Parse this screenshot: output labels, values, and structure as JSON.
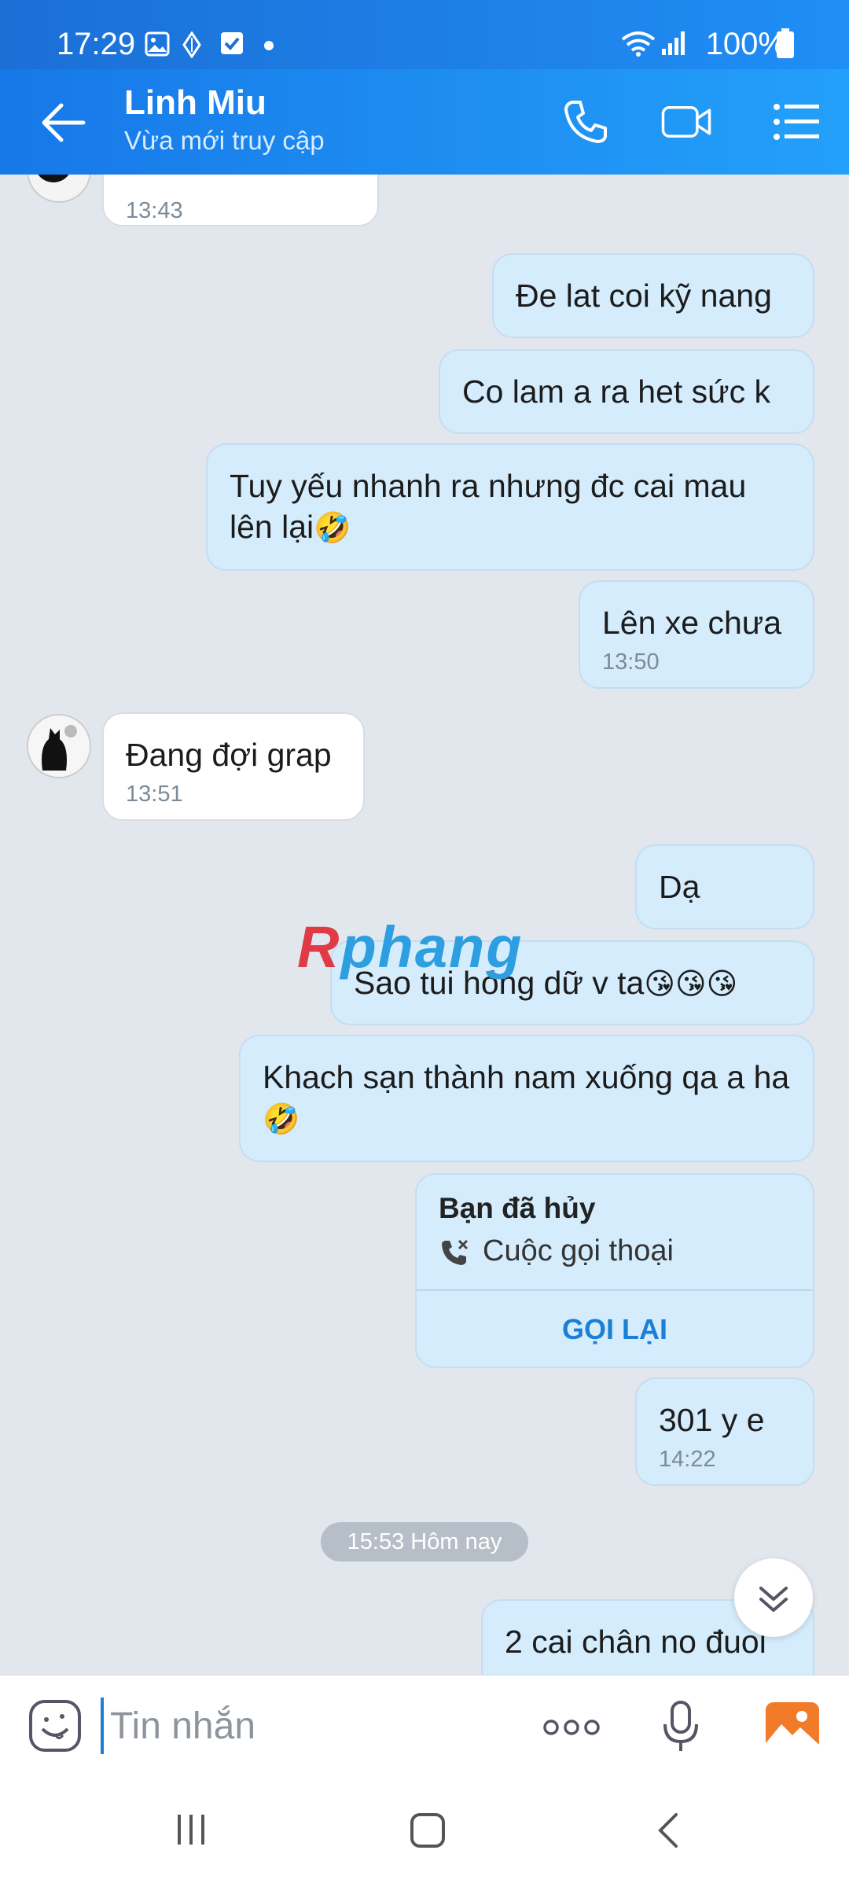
{
  "status_bar": {
    "time": "17:29",
    "battery": "100%"
  },
  "header": {
    "contact_name": "Linh Miu",
    "contact_status": "Vừa mới truy cập"
  },
  "messages": [
    {
      "dir": "in",
      "time": "13:43"
    },
    {
      "dir": "out",
      "text": "Đe lat coi kỹ nang"
    },
    {
      "dir": "out",
      "text": "Co lam a ra het sức k"
    },
    {
      "dir": "out",
      "text": "Tuy yếu nhanh ra nhưng đc cai mau lên lại",
      "emoji": "🤣"
    },
    {
      "dir": "out",
      "text": "Lên xe chưa",
      "time": "13:50"
    },
    {
      "dir": "in",
      "text": "Đang đợi grap",
      "time": "13:51"
    },
    {
      "dir": "out",
      "text": "Dạ"
    },
    {
      "dir": "out",
      "text": "Sao tui hóng dữ v ta",
      "emoji": "😘😘😘"
    },
    {
      "dir": "out",
      "text": "Khach sạn thành nam xuống qa a ha",
      "emoji": "🤣"
    },
    {
      "dir": "out",
      "text": "301 y e",
      "time": "14:22"
    },
    {
      "dir": "out",
      "text": "2 cai chân no đuoi"
    }
  ],
  "call_card": {
    "title": "Bạn đã hủy",
    "subtitle": "Cuộc gọi thoại",
    "action": "GỌI LẠI"
  },
  "date_separator": "15:53 Hôm nay",
  "watermark": {
    "part1": "R",
    "part2": "phang"
  },
  "composer": {
    "placeholder": "Tin nhắn"
  },
  "colors": {
    "header": "#1f8ef5",
    "outgoing_bubble": "#d5ecfc",
    "incoming_bubble": "#ffffff",
    "accent": "#1a7fd6"
  },
  "icons": [
    "back-arrow-icon",
    "phone-icon",
    "video-camera-icon",
    "menu-list-icon",
    "emoji-icon",
    "more-dots-icon",
    "microphone-icon",
    "gallery-icon"
  ]
}
